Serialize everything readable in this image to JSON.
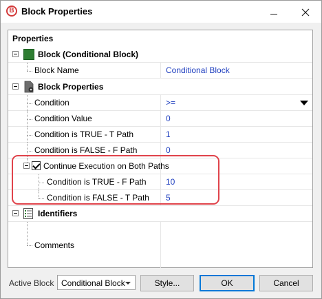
{
  "window": {
    "title": "Block Properties",
    "app_icon_letter": "B",
    "minimize_icon": "minimize-icon",
    "close_icon": "close-icon"
  },
  "panel": {
    "header": "Properties",
    "categories": [
      {
        "label": "Block (Conditional Block)",
        "icon": "green-block-icon"
      },
      {
        "label": "Block Properties",
        "icon": "document-gear-icon"
      },
      {
        "label": "Identifiers",
        "icon": "identifiers-list-icon"
      }
    ],
    "rows": {
      "block_name": {
        "label": "Block Name",
        "value": "Conditional Block"
      },
      "condition": {
        "label": "Condition",
        "value": ">="
      },
      "condition_value": {
        "label": "Condition Value",
        "value": "0"
      },
      "true_t_path": {
        "label": "Condition is TRUE - T Path",
        "value": "1"
      },
      "false_f_path": {
        "label": "Condition is FALSE - F Path",
        "value": "0"
      },
      "continue_both": {
        "label": "Continue Execution on Both Paths",
        "checked": true
      },
      "true_f_path": {
        "label": "Condition is TRUE - F Path",
        "value": "10"
      },
      "false_t_path": {
        "label": "Condition is FALSE - T Path",
        "value": "5"
      },
      "comments": {
        "label": "Comments",
        "value": ""
      }
    }
  },
  "footer": {
    "active_block_label": "Active Block",
    "active_block_value": "Conditional Block",
    "style_button": "Style...",
    "ok_button": "OK",
    "cancel_button": "Cancel"
  },
  "colors": {
    "value_text": "#1f3fbf",
    "highlight_border": "#e0434b",
    "block_icon": "#2e7d32"
  }
}
